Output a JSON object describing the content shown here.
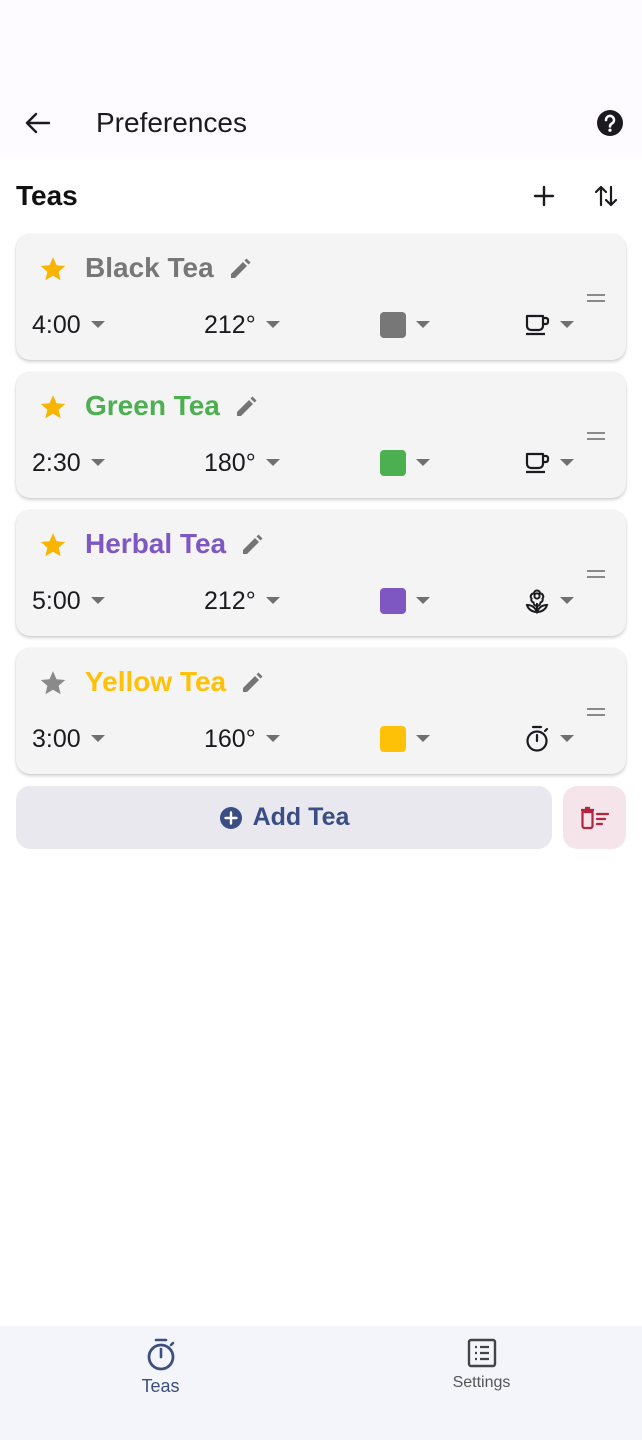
{
  "header": {
    "title": "Preferences"
  },
  "section": {
    "title": "Teas"
  },
  "teas": [
    {
      "name": "Black Tea",
      "color": "#777777",
      "favorite": true,
      "time": "4:00",
      "temp": "212°",
      "icon": "cup-icon"
    },
    {
      "name": "Green Tea",
      "color": "#4caf50",
      "favorite": true,
      "time": "2:30",
      "temp": "180°",
      "icon": "cup-icon"
    },
    {
      "name": "Herbal Tea",
      "color": "#7e57c2",
      "favorite": true,
      "time": "5:00",
      "temp": "212°",
      "icon": "flower-icon"
    },
    {
      "name": "Yellow Tea",
      "color": "#ffc107",
      "favorite": false,
      "time": "3:00",
      "temp": "160°",
      "icon": "timer-icon"
    }
  ],
  "actions": {
    "add_label": "Add Tea"
  },
  "nav": {
    "teas_label": "Teas",
    "settings_label": "Settings"
  },
  "colors": {
    "accent": "#3a4e85",
    "star_on": "#f9b400",
    "star_off": "#8a8a8a",
    "delete": "#b3243f"
  }
}
